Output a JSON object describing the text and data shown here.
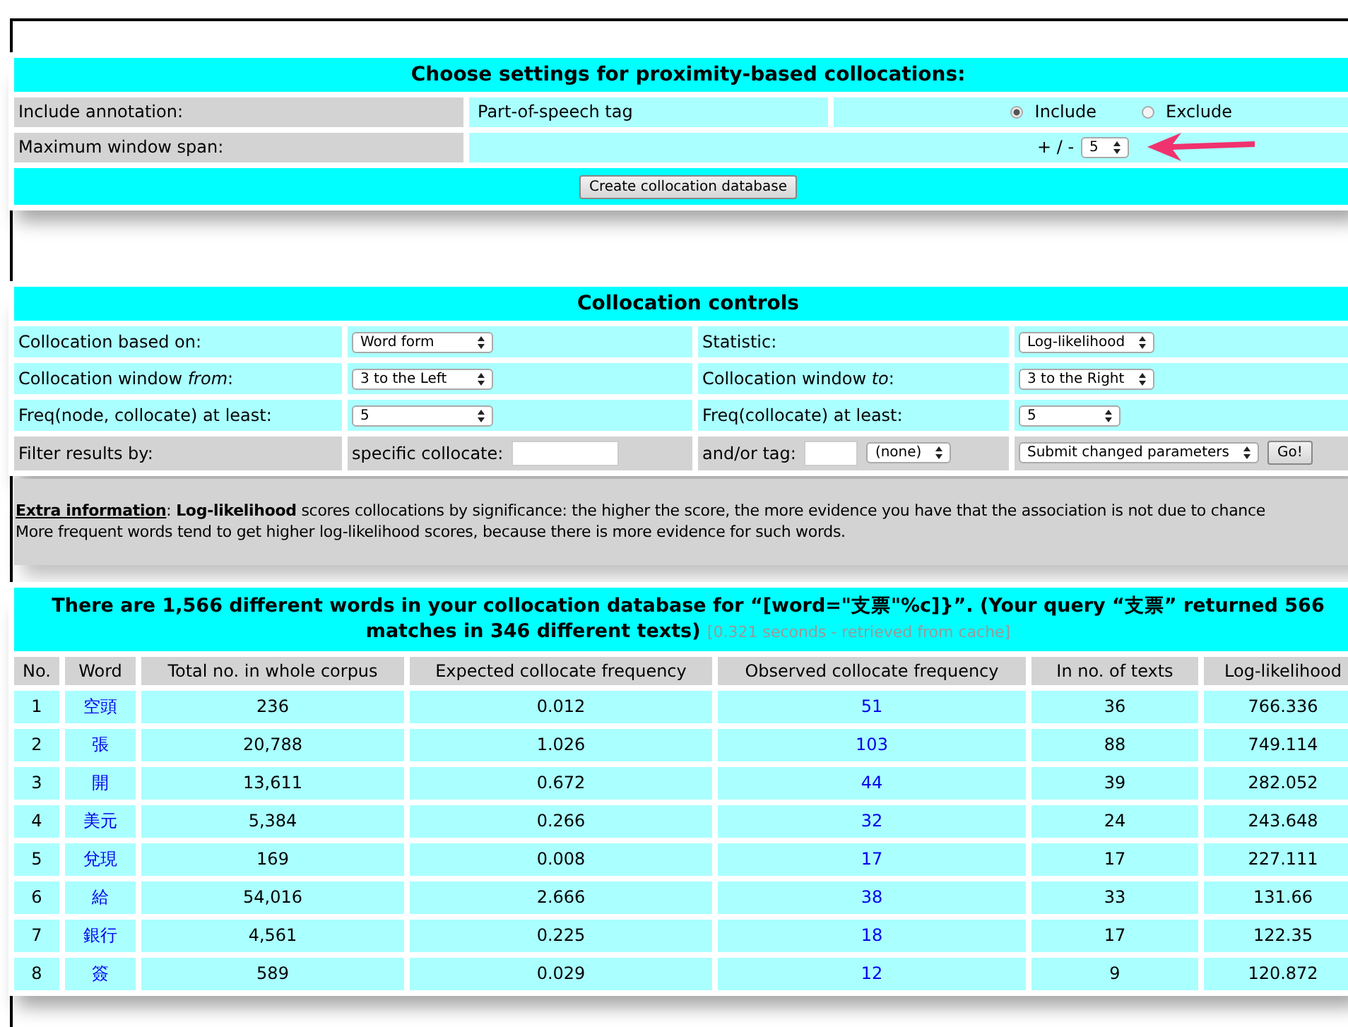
{
  "settings": {
    "title": "Choose settings for proximity-based collocations:",
    "annotation_label": "Include annotation:",
    "annotation_value": "Part-of-speech tag",
    "radios": [
      {
        "label": "Include",
        "selected": true
      },
      {
        "label": "Exclude",
        "selected": false
      }
    ],
    "span_label": "Maximum window span:",
    "span_prefix": "+ / -",
    "span_value": "5",
    "create_button": "Create collocation database"
  },
  "controls": {
    "title": "Collocation controls",
    "rows": [
      {
        "label1": "Collocation based on:",
        "select1": "Word form",
        "label2": "Statistic:",
        "select2": "Log-likelihood"
      },
      {
        "label1": "Collocation window *from*:",
        "select1": "3 to the Left",
        "label2": "Collocation window *to*:",
        "select2": "3 to the Right"
      },
      {
        "label1": "Freq(node, collocate) at least:",
        "select1": "5",
        "label2": "Freq(collocate) at least:",
        "select2": "5"
      }
    ],
    "filter_label": "Filter results by:",
    "collocate_label": "specific collocate:",
    "tag_label": "and/or tag:",
    "tag_select": "(none)",
    "action_select": "Submit changed parameters",
    "go_button": "Go!"
  },
  "extra_info": [
    "**Extra information**: **Log-likelihood** scores collocations by significance: the higher the score, the more evidence you have that the association is not due to chance",
    "More frequent words tend to get higher log-likelihood scores, because there is more evidence for such words."
  ],
  "results": {
    "heading": "There are 1,566 different words in your collocation database for “[word=\"支票\"%c]}”. (Your query “支票” returned 566 matches in 346 different texts)",
    "timing": "[0.321 seconds - retrieved from cache]",
    "columns": [
      "No.",
      "Word",
      "Total no. in whole corpus",
      "Expected collocate frequency",
      "Observed collocate frequency",
      "In no. of texts",
      "Log-likelihood"
    ],
    "rows": [
      [
        "1",
        "空頭",
        "236",
        "0.012",
        "51",
        "36",
        "766.336"
      ],
      [
        "2",
        "張",
        "20,788",
        "1.026",
        "103",
        "88",
        "749.114"
      ],
      [
        "3",
        "開",
        "13,611",
        "0.672",
        "44",
        "39",
        "282.052"
      ],
      [
        "4",
        "美元",
        "5,384",
        "0.266",
        "32",
        "24",
        "243.648"
      ],
      [
        "5",
        "兌現",
        "169",
        "0.008",
        "17",
        "17",
        "227.111"
      ],
      [
        "6",
        "給",
        "54,016",
        "2.666",
        "38",
        "33",
        "131.66"
      ],
      [
        "7",
        "銀行",
        "4,561",
        "0.225",
        "18",
        "17",
        "122.35"
      ],
      [
        "8",
        "簽",
        "589",
        "0.029",
        "12",
        "9",
        "120.872"
      ]
    ]
  }
}
